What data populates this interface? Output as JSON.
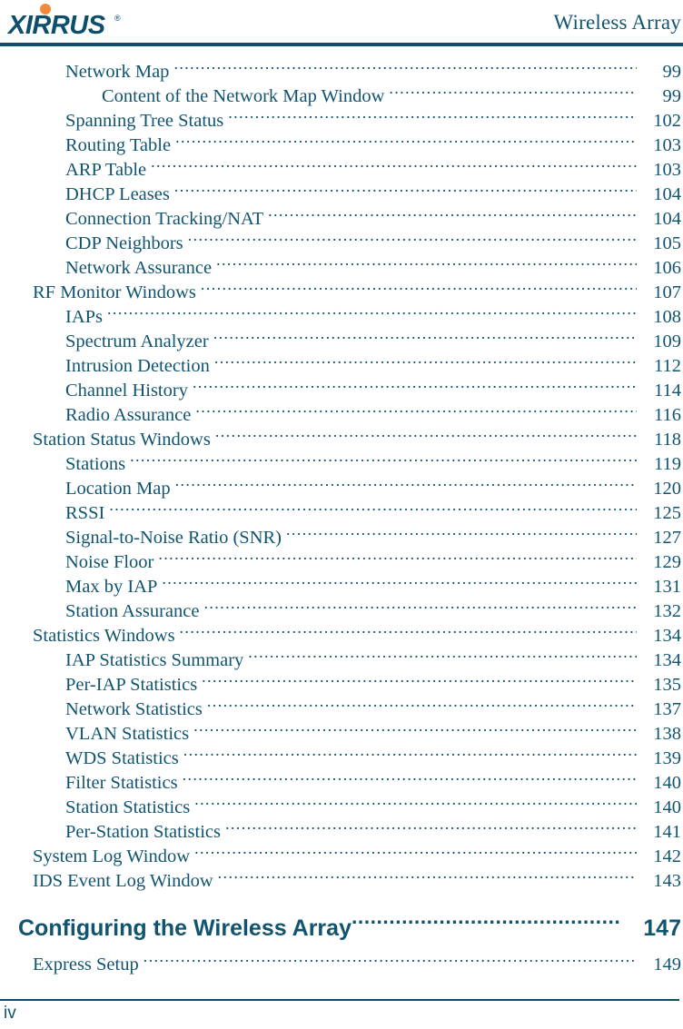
{
  "header": {
    "logo_text": "XIRRUS",
    "logo_trademark": "®",
    "logo_icon": "xirrus-logo",
    "title": "Wireless Array",
    "brand_color": "#0d4f6b",
    "accent_color": "#f08a3c"
  },
  "toc": {
    "entries": [
      {
        "level": 2,
        "label": "Network Map",
        "page": "99"
      },
      {
        "level": 3,
        "label": "Content of the Network Map Window",
        "page": "99"
      },
      {
        "level": 2,
        "label": "Spanning Tree Status",
        "page": "102"
      },
      {
        "level": 2,
        "label": "Routing Table",
        "page": "103"
      },
      {
        "level": 2,
        "label": "ARP Table",
        "page": "103"
      },
      {
        "level": 2,
        "label": "DHCP Leases",
        "page": "104"
      },
      {
        "level": 2,
        "label": "Connection Tracking/NAT",
        "page": "104"
      },
      {
        "level": 2,
        "label": "CDP Neighbors",
        "page": "105"
      },
      {
        "level": 2,
        "label": "Network Assurance",
        "page": "106"
      },
      {
        "level": 1,
        "label": "RF Monitor Windows",
        "page": "107"
      },
      {
        "level": 2,
        "label": "IAPs",
        "page": "108"
      },
      {
        "level": 2,
        "label": "Spectrum Analyzer",
        "page": "109"
      },
      {
        "level": 2,
        "label": "Intrusion Detection",
        "page": "112"
      },
      {
        "level": 2,
        "label": "Channel History",
        "page": "114"
      },
      {
        "level": 2,
        "label": "Radio Assurance",
        "page": "116"
      },
      {
        "level": 1,
        "label": "Station Status Windows",
        "page": "118"
      },
      {
        "level": 2,
        "label": "Stations",
        "page": "119"
      },
      {
        "level": 2,
        "label": "Location Map",
        "page": "120"
      },
      {
        "level": 2,
        "label": "RSSI",
        "page": "125"
      },
      {
        "level": 2,
        "label": "Signal-to-Noise Ratio (SNR)",
        "page": "127"
      },
      {
        "level": 2,
        "label": "Noise Floor",
        "page": "129"
      },
      {
        "level": 2,
        "label": "Max by IAP",
        "page": "131"
      },
      {
        "level": 2,
        "label": "Station Assurance",
        "page": "132"
      },
      {
        "level": 1,
        "label": "Statistics Windows",
        "page": "134"
      },
      {
        "level": 2,
        "label": "IAP Statistics Summary",
        "page": "134"
      },
      {
        "level": 2,
        "label": "Per-IAP Statistics",
        "page": "135"
      },
      {
        "level": 2,
        "label": "Network Statistics",
        "page": "137"
      },
      {
        "level": 2,
        "label": "VLAN Statistics",
        "page": "138"
      },
      {
        "level": 2,
        "label": "WDS Statistics",
        "page": "139"
      },
      {
        "level": 2,
        "label": "Filter Statistics",
        "page": "140"
      },
      {
        "level": 2,
        "label": "Station Statistics",
        "page": "140"
      },
      {
        "level": 2,
        "label": "Per-Station Statistics",
        "page": "141"
      },
      {
        "level": 1,
        "label": "System Log Window",
        "page": "142"
      },
      {
        "level": 1,
        "label": "IDS Event Log Window",
        "page": "143"
      }
    ],
    "chapter": {
      "label": "Configuring the Wireless Array",
      "page": "147"
    },
    "after_chapter": [
      {
        "level": 1,
        "label": "Express Setup",
        "page": "149"
      }
    ]
  },
  "footer": {
    "folio": "iv"
  }
}
